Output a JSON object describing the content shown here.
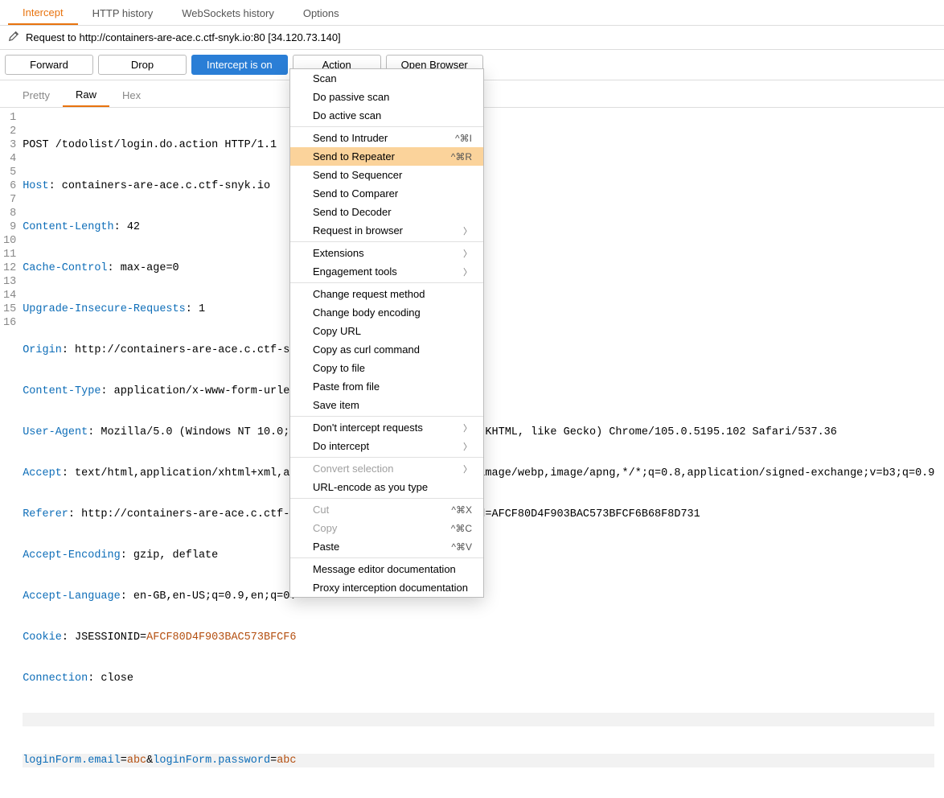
{
  "tabs": {
    "intercept": "Intercept",
    "http": "HTTP history",
    "ws": "WebSockets history",
    "options": "Options"
  },
  "request_line": "Request to http://containers-are-ace.c.ctf-snyk.io:80  [34.120.73.140]",
  "toolbar": {
    "forward": "Forward",
    "drop": "Drop",
    "intercept": "Intercept is on",
    "action": "Action",
    "open": "Open Browser"
  },
  "view_tabs": {
    "pretty": "Pretty",
    "raw": "Raw",
    "hex": "Hex"
  },
  "menu": {
    "scan": "Scan",
    "passive": "Do passive scan",
    "active": "Do active scan",
    "intruder": "Send to Intruder",
    "intruder_acc": "^⌘I",
    "repeater": "Send to Repeater",
    "repeater_acc": "^⌘R",
    "sequencer": "Send to Sequencer",
    "comparer": "Send to Comparer",
    "decoder": "Send to Decoder",
    "reqbrowser": "Request in browser",
    "extensions": "Extensions",
    "engagement": "Engagement tools",
    "chmethod": "Change request method",
    "chbody": "Change body encoding",
    "copyurl": "Copy URL",
    "copycurl": "Copy as curl command",
    "copyfile": "Copy to file",
    "pastefile": "Paste from file",
    "save": "Save item",
    "dontint": "Don't intercept requests",
    "doint": "Do intercept",
    "convsel": "Convert selection",
    "urlenc": "URL-encode as you type",
    "cut": "Cut",
    "cut_acc": "^⌘X",
    "copy": "Copy",
    "copy_acc": "^⌘C",
    "paste": "Paste",
    "paste_acc": "^⌘V",
    "msgdoc": "Message editor documentation",
    "proxydoc": "Proxy interception documentation"
  },
  "request": {
    "l1_a": "POST /todolist/login.do.action HTTP/1.1",
    "l2_h": "Host",
    "l2_v": ": containers-are-ace.c.ctf-snyk.io",
    "l3_h": "Content-Length",
    "l3_v": ": 42",
    "l4_h": "Cache-Control",
    "l4_v": ": max-age=0",
    "l5_h": "Upgrade-Insecure-Requests",
    "l5_v": ": 1",
    "l6_h": "Origin",
    "l6_v": ": http://containers-are-ace.c.ctf-sn",
    "l7_h": "Content-Type",
    "l7_v": ": application/x-www-form-urlen",
    "l8_h": "User-Agent",
    "l8_v": ": Mozilla/5.0 (Windows NT 10.0;                             (KHTML, like Gecko) Chrome/105.0.5195.102 Safari/537.36",
    "l9_h": "Accept",
    "l9_v": ": text/html,application/xhtml+xml,ap                            image/webp,image/apng,*/*;q=0.8,application/signed-exchange;v=b3;q=0.9",
    "l10_h": "Referer",
    "l10_v": ": http://containers-are-ace.c.ctf-s                            d=AFCF80D4F903BAC573BFCF6B68F8D731",
    "l11_h": "Accept-Encoding",
    "l11_v": ": gzip, deflate",
    "l12_h": "Accept-Language",
    "l12_v": ": en-GB,en-US;q=0.9,en;q=0.",
    "l13_h": "Cookie",
    "l13_v1": ": JSESSIONID=",
    "l13_v2": "AFCF80D4F903BAC573BFCF6",
    "l14_h": "Connection",
    "l14_v": ": close",
    "l16_k1": "loginForm.email",
    "l16_e": "=",
    "l16_v1": "abc",
    "l16_amp": "&",
    "l16_k2": "loginForm.password",
    "l16_v2": "abc"
  }
}
